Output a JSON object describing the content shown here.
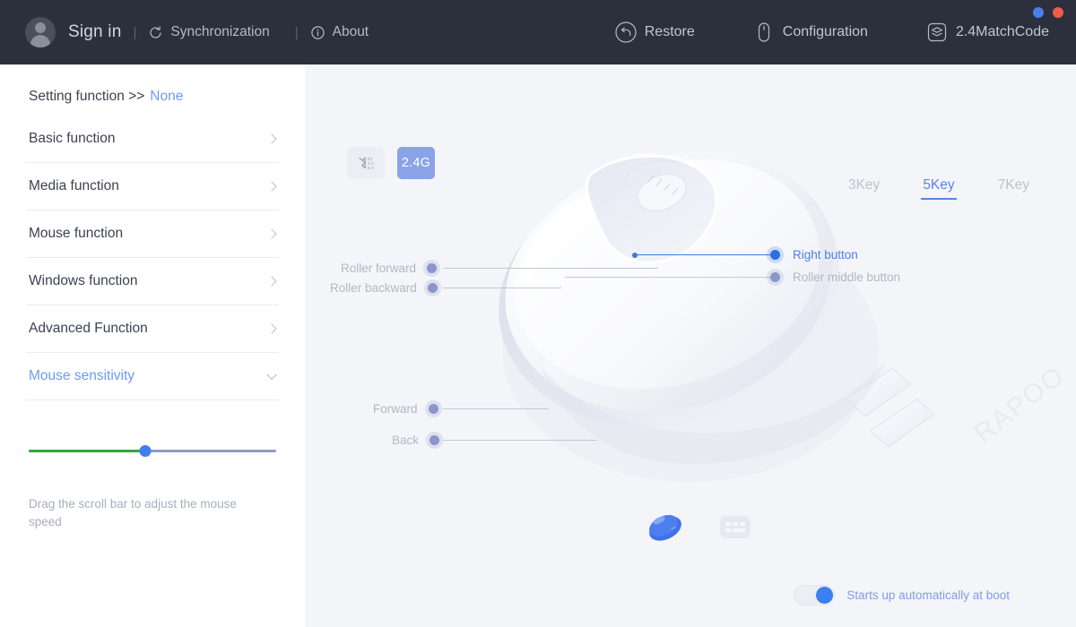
{
  "window": {
    "controls": [
      {
        "name": "minimize",
        "color": "#4a7ef0"
      },
      {
        "name": "close",
        "color": "#f05a4a"
      }
    ]
  },
  "header": {
    "avatar_icon": "user-avatar-icon",
    "sign_in": "Sign in",
    "separator": "|",
    "left_items": [
      {
        "label": "Synchronization",
        "icon": "sync-icon"
      },
      {
        "label": "About",
        "icon": "info-icon"
      }
    ],
    "right_items": [
      {
        "label": "Restore",
        "icon": "restore-icon"
      },
      {
        "label": "Configuration",
        "icon": "mouse-icon"
      },
      {
        "label": "2.4MatchCode",
        "icon": "stack-icon"
      }
    ]
  },
  "sidebar": {
    "setting_prefix": "Setting function >>",
    "setting_value": "None",
    "items": [
      {
        "label": "Basic function",
        "chevron": "chevron-right-icon",
        "active": false
      },
      {
        "label": "Media function",
        "chevron": "chevron-right-icon",
        "active": false
      },
      {
        "label": "Mouse function",
        "chevron": "chevron-right-icon",
        "active": false
      },
      {
        "label": "Windows function",
        "chevron": "chevron-right-icon",
        "active": false
      },
      {
        "label": "Advanced Function",
        "chevron": "chevron-right-icon",
        "active": false
      },
      {
        "label": "Mouse sensitivity",
        "chevron": "chevron-down-icon",
        "active": true
      }
    ],
    "slider": {
      "value_percent": 47,
      "fill_color": "#35a541",
      "track_color": "#8e9cc9",
      "thumb_color": "#3d7ef0"
    },
    "hint": "Drag the scroll bar to adjust the mouse speed"
  },
  "main": {
    "connection": {
      "bluetooth": {
        "label": "BT\n3.0\n5.0",
        "icon": "bluetooth-icon",
        "selected": false
      },
      "rf24": {
        "label": "2.4G",
        "selected": true
      }
    },
    "key_tabs": [
      {
        "label": "3Key",
        "active": false
      },
      {
        "label": "5Key",
        "active": true
      },
      {
        "label": "7Key",
        "active": false
      }
    ],
    "device_image": {
      "name": "mouse-illustration",
      "brand": "RAPOO"
    },
    "callouts": [
      {
        "label": "Roller forward",
        "side": "left",
        "highlighted": false
      },
      {
        "label": "Roller backward",
        "side": "left",
        "highlighted": false
      },
      {
        "label": "Forward",
        "side": "left",
        "highlighted": false
      },
      {
        "label": "Back",
        "side": "left",
        "highlighted": false
      },
      {
        "label": "Right button",
        "side": "right",
        "highlighted": true
      },
      {
        "label": "Roller middle button",
        "side": "right",
        "highlighted": false
      }
    ],
    "devices": [
      {
        "name": "mouse-device",
        "icon": "mouse-device-icon",
        "selected": true
      },
      {
        "name": "keyboard-device",
        "icon": "keyboard-device-icon",
        "selected": false
      }
    ],
    "boot": {
      "label": "Starts up automatically at boot",
      "enabled": true
    }
  }
}
